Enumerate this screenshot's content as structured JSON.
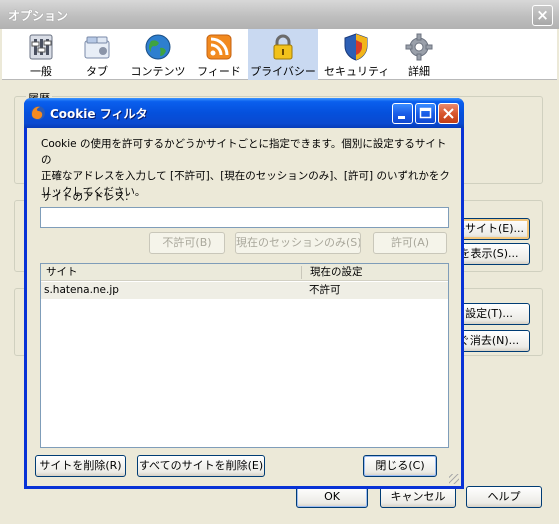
{
  "main_window": {
    "title": "オプション",
    "close_glyph": "×",
    "toolbar": [
      {
        "label": "一般",
        "icon": "general-icon",
        "selected": false
      },
      {
        "label": "タブ",
        "icon": "tabs-icon",
        "selected": false
      },
      {
        "label": "コンテンツ",
        "icon": "content-icon",
        "selected": false
      },
      {
        "label": "フィード",
        "icon": "feed-icon",
        "selected": false
      },
      {
        "label": "プライバシー",
        "icon": "privacy-lock-icon",
        "selected": true
      },
      {
        "label": "セキュリティ",
        "icon": "security-shield-icon",
        "selected": false
      },
      {
        "label": "詳細",
        "icon": "advanced-gear-icon",
        "selected": false
      }
    ],
    "section_legend": "履歴",
    "side_buttons": {
      "exceptions": "外サイト(E)...",
      "show_cookies": "を表示(S)...",
      "settings": "設定(T)...",
      "clear_now": "ぐ消去(N)..."
    },
    "bottom_buttons": {
      "ok": "OK",
      "cancel": "キャンセル",
      "help": "ヘルプ"
    }
  },
  "dialog": {
    "title": "Cookie フィルタ",
    "description_lines": [
      "Cookie の使用を許可するかどうかサイトごとに指定できます。個別に設定するサイトの",
      "正確なアドレスを入力して [不許可]、[現在のセッションのみ]、[許可] のいずれかをク",
      "リックしてください。"
    ],
    "address_label": "サイトのアドレス:",
    "address_value": "",
    "buttons": {
      "block": "不許可(B)",
      "session": "現在のセッションのみ(S)",
      "allow": "許可(A)",
      "remove_site": "サイトを削除(R)",
      "remove_all": "すべてのサイトを削除(E)",
      "close": "閉じる(C)"
    },
    "table": {
      "columns": [
        "サイト",
        "現在の設定"
      ],
      "rows": [
        {
          "site": "s.hatena.ne.jp",
          "status": "不許可"
        }
      ]
    }
  }
}
